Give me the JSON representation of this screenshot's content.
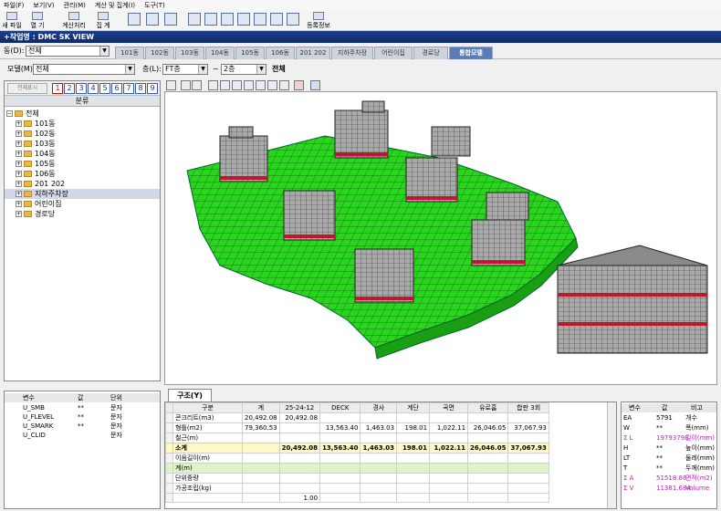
{
  "menu": [
    "파일(F)",
    "보기(V)",
    "관리(M)",
    "계산 및 집계(I)",
    "도구(T)"
  ],
  "toolbar": {
    "new_file": "새 파일",
    "open": "열 기",
    "calculate": "계산처리",
    "summary": "집 계",
    "register_info": "등록정보"
  },
  "title": "+작업명 : DMC SK VIEW",
  "building_selector": {
    "label": "동(D):",
    "value": "전체"
  },
  "building_tabs": [
    "101동",
    "102동",
    "103동",
    "104동",
    "105동",
    "106동",
    "201 202",
    "지하주차장",
    "어린이집",
    "경로당",
    "통합모델"
  ],
  "active_tab": "통합모델",
  "model_selector": {
    "label": "모델(M):",
    "value": "전체"
  },
  "floor_selector": {
    "label": "층(L):",
    "from": "FT층",
    "to": "2층",
    "tilde": "~",
    "suffix": "전체"
  },
  "left_toolbar": {
    "button": "전체표시",
    "numbers": [
      "1",
      "2",
      "3",
      "4",
      "5",
      "6",
      "7",
      "8",
      "9"
    ]
  },
  "classification_header": "분류",
  "tree": {
    "root": "전체",
    "items": [
      "101동",
      "102동",
      "103동",
      "104동",
      "105동",
      "106동",
      "201 202",
      "지하주차장",
      "어린이집",
      "경로당"
    ],
    "selected": "지하주차장"
  },
  "variables": {
    "headers": [
      "변수",
      "값",
      "단위"
    ],
    "rows": [
      {
        "name": "U_SMB",
        "value": "**",
        "unit": "문자"
      },
      {
        "name": "U_FLEVEL",
        "value": "**",
        "unit": "문자"
      },
      {
        "name": "U_SMARK",
        "value": "**",
        "unit": "문자"
      },
      {
        "name": "U_CLID",
        "value": "",
        "unit": "문자"
      }
    ]
  },
  "structure_tab": "구조(Y)",
  "table": {
    "headers": [
      "구분",
      "계",
      "25-24-12",
      "DECK",
      "경사",
      "계단",
      "곡면",
      "유로홈",
      "합판 3회"
    ],
    "rows": [
      {
        "name": "콘크리트(m3)",
        "cells": [
          "20,492.08",
          "20,492.08",
          "",
          "",
          "",
          "",
          "",
          ""
        ],
        "style": ""
      },
      {
        "name": "형틀(m2)",
        "cells": [
          "79,360.53",
          "",
          "13,563.40",
          "1,463.03",
          "198.01",
          "1,022.11",
          "26,046.05",
          "37,067.93"
        ],
        "style": ""
      },
      {
        "name": "철근(m)",
        "cells": [
          "",
          "",
          "",
          "",
          "",
          "",
          "",
          ""
        ],
        "style": ""
      },
      {
        "name": "소계",
        "cells": [
          "",
          "20,492.08",
          "13,563.40",
          "1,463.03",
          "198.01",
          "1,022.11",
          "26,046.05",
          "37,067.93"
        ],
        "style": "sub"
      },
      {
        "name": "이음길이(m)",
        "cells": [
          "",
          "",
          "",
          "",
          "",
          "",
          "",
          ""
        ],
        "style": ""
      },
      {
        "name": "계(m)",
        "cells": [
          "",
          "",
          "",
          "",
          "",
          "",
          "",
          ""
        ],
        "style": "green"
      },
      {
        "name": "단위중량",
        "cells": [
          "",
          "",
          "",
          "",
          "",
          "",
          "",
          ""
        ],
        "style": ""
      },
      {
        "name": "가공조립(kg)",
        "cells": [
          "",
          "",
          "",
          "",
          "",
          "",
          "",
          ""
        ],
        "style": ""
      },
      {
        "name": "",
        "cells": [
          "",
          "1.00",
          "",
          "",
          "",
          "",
          "",
          ""
        ],
        "style": ""
      }
    ]
  },
  "properties": {
    "headers": [
      "변수",
      "값",
      "비고"
    ],
    "rows": [
      {
        "name": "EA",
        "value": "5791",
        "note": "개수",
        "highlight": false
      },
      {
        "name": "W",
        "value": "**",
        "note": "폭(mm)",
        "highlight": false
      },
      {
        "name": "Σ L",
        "value": "19793798",
        "note": "길이(mm)",
        "highlight": true
      },
      {
        "name": "H",
        "value": "**",
        "note": "높이(mm)",
        "highlight": false
      },
      {
        "name": "LT",
        "value": "**",
        "note": "둘레(mm)",
        "highlight": false
      },
      {
        "name": "T",
        "value": "**",
        "note": "두께(mm)",
        "highlight": false
      },
      {
        "name": "Σ A",
        "value": "51518.86",
        "note": "면적(m2)",
        "highlight": true
      },
      {
        "name": "Σ V",
        "value": "11381.684",
        "note": "Volume",
        "highlight": true
      }
    ]
  },
  "colors": {
    "slab": "#28d21c",
    "building": "#9c9c9c",
    "accent_red": "#c0182a",
    "title_bar": "#0f2a6b",
    "active_tab": "#5a7db8",
    "highlight_text": "#c020c0"
  }
}
